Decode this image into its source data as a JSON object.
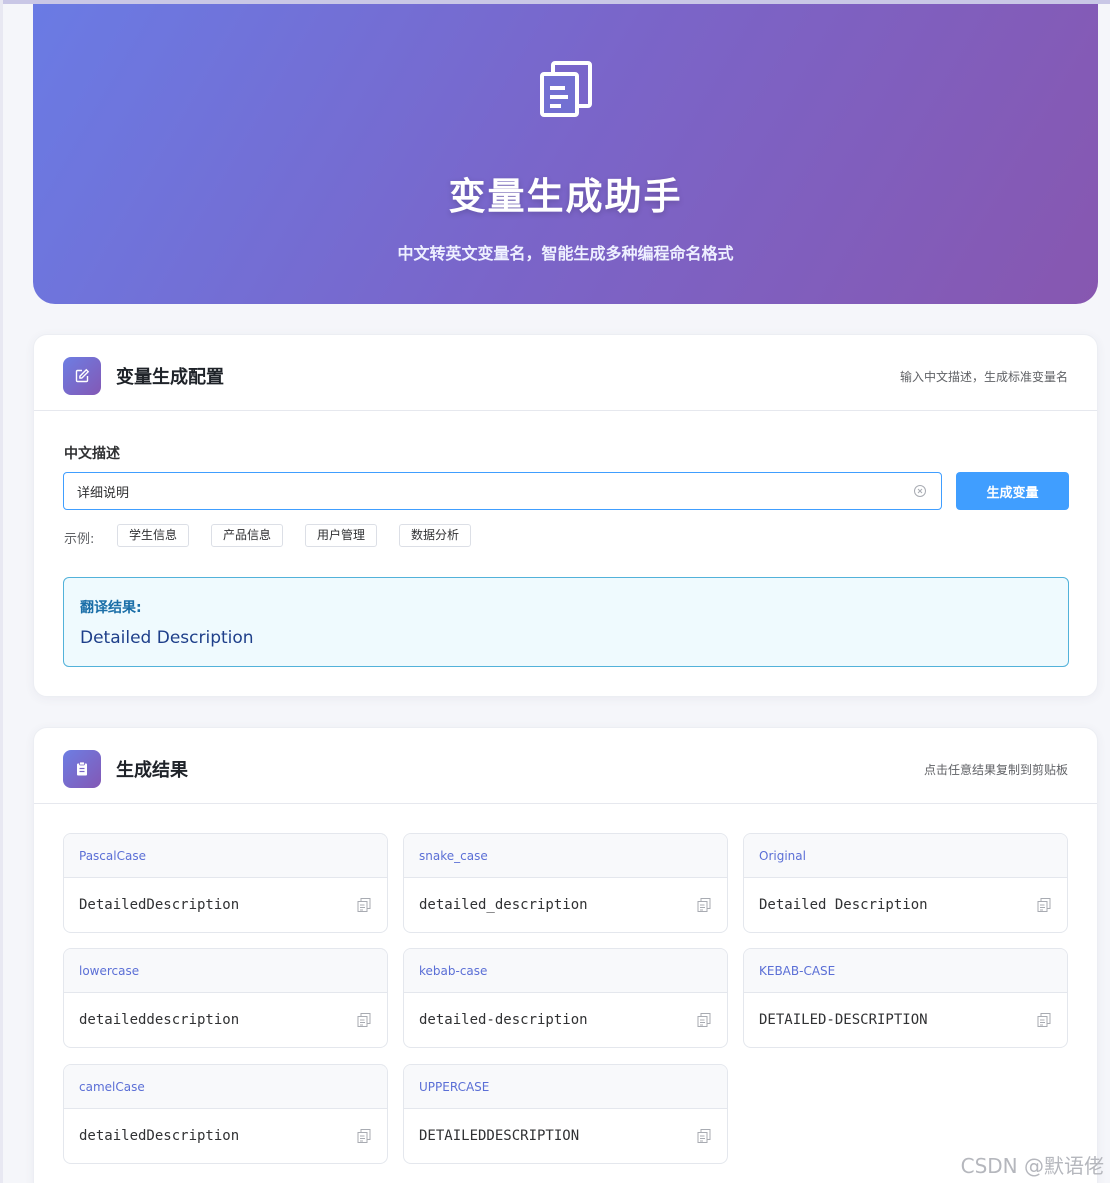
{
  "hero": {
    "title": "变量生成助手",
    "subtitle": "中文转英文变量名，智能生成多种编程命名格式",
    "icon": "copy-document-icon"
  },
  "config": {
    "title": "变量生成配置",
    "hint": "输入中文描述，生成标准变量名",
    "icon": "edit-icon",
    "field_label": "中文描述",
    "input_value": "详细说明",
    "generate_label": "生成变量",
    "examples_label": "示例:",
    "examples": [
      "学生信息",
      "产品信息",
      "用户管理",
      "数据分析"
    ],
    "translation_label": "翻译结果:",
    "translation_value": "Detailed Description"
  },
  "results": {
    "title": "生成结果",
    "hint": "点击任意结果复制到剪贴板",
    "icon": "clipboard-icon",
    "items": [
      {
        "name": "PascalCase",
        "value": "DetailedDescription"
      },
      {
        "name": "snake_case",
        "value": "detailed_description"
      },
      {
        "name": "Original",
        "value": "Detailed Description"
      },
      {
        "name": "lowercase",
        "value": "detaileddescription"
      },
      {
        "name": "kebab-case",
        "value": "detailed-description"
      },
      {
        "name": "KEBAB-CASE",
        "value": "DETAILED-DESCRIPTION"
      },
      {
        "name": "camelCase",
        "value": "detailedDescription"
      },
      {
        "name": "UPPERCASE",
        "value": "DETAILEDDESCRIPTION"
      }
    ]
  },
  "watermark": "CSDN @默语佬",
  "colors": {
    "primary": "#409eff",
    "gradient_start": "#6a7be4",
    "gradient_end": "#8757b0",
    "accent_text": "#5b6fd6"
  }
}
